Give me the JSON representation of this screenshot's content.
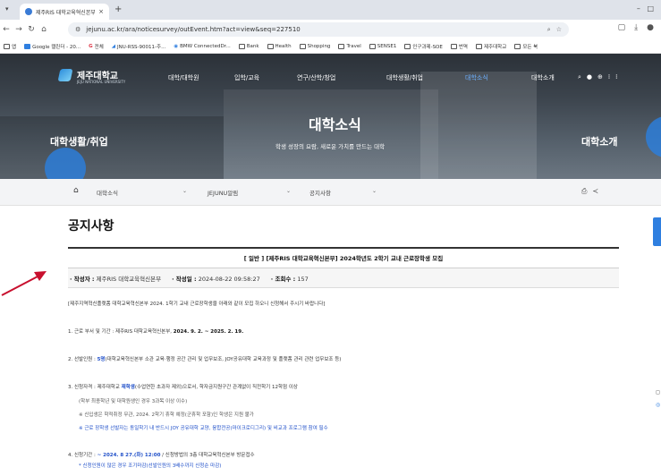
{
  "browser": {
    "tab_title": "제주RIS 대학교육혁신본부 2",
    "tab_close": "×",
    "new_tab": "+",
    "url": "jejunu.ac.kr/ara/noticesurvey/outEvent.htm?act=view&seq=227510",
    "bookmarks": [
      "앱",
      "Google 캘린더 - 20...",
      "전체",
      "JNU-RSS-90011-주...",
      "BMW ConnectedDr...",
      "Bank",
      "Health",
      "Shopping",
      "Travel",
      "SENSE1",
      "인구과제-SOE",
      "번역",
      "제주대학교",
      "모든 북"
    ]
  },
  "site": {
    "logo_name": "제주대학교",
    "logo_sub": "JEJU NATIONAL UNIVERSITY",
    "nav": [
      "대학/대학원",
      "입학/교육",
      "연구/산학/창업",
      "대학생활/취업",
      "대학소식",
      "대학소개"
    ],
    "hero_title": "대학소식",
    "hero_subtitle": "학생 성장의 요람, 새로운 가치를 만드는 대학",
    "hero_left": "대학생활/취업",
    "hero_right": "대학소개"
  },
  "breadcrumb": [
    "대학소식",
    "JEJUNU알림",
    "공지사항"
  ],
  "content": {
    "page_title": "공지사항",
    "post_title": "[ 일반 ] [제주RIS 대학교육혁신본부] 2024학년도 2학기 교내 근로장학생 모집",
    "author_label": "· 작성자 :",
    "author": "제주RIS 대학교육혁신본부",
    "date_label": "· 작성일 :",
    "date": "2024-08-22 09:58:27",
    "views_label": "· 조회수 :",
    "views": "157",
    "lines": {
      "intro": "[제주지역혁신플랫폼 대학교육혁신본부 2024. 1학기 교내 근로장학생을 아래와 같이 모집 하오니 신청해서 주시기 바랍니다]",
      "l1_prefix": "1. 근로 부서 및 기간 : 제주RIS 대학교육혁신본부, ",
      "l1_period": "2024. 9. 2. ~ 2025. 2. 19.",
      "l2_prefix": "2. 선발인원 : ",
      "l2_count": "5명",
      "l2_rest": "(대학교육혁신본부 소관 교육·행정 공간 관리 및 업무보조, JOY공유대학 교육과정 및 플랫폼 관리 관련 업무보조 등)",
      "l3_prefix": "3. 신청자격 : 제주대학교 ",
      "l3_hl": "재학생",
      "l3_rest": "(수업연한 초과자 제외)으로서, 학자금지원구간 관계없이 직전학기 12학점 이상",
      "l3_sub1": "(학부 최종학년 및 대학원생인 경우 3과목 이상 이수)",
      "l3_sub2": "※ 신입생은 학적취정 무관, 2024. 2학기 휴학 예정(군휴학 포함)인 학생은 지원 불가",
      "l3_sub3": "※ 근로 장학생 선발자는 동일학기 내 반드시 JOY 공유대학 교양, 융합전공(마이크로디그리) 및 비교과 프로그램 참여 필수",
      "l4_prefix": "4. 신청기간 : ",
      "l4_hl": "~ 2024. 8 27.(화) 12:00",
      "l4_rest": " / 신청방법의 3층 대학교육혁신본부 방문접수",
      "l4_sub": "* 신청인원이 많은 경우 조기마감(선발인원의 3배수까지 신청순 마감)"
    }
  },
  "colors": {
    "accent": "#2f7fe0",
    "link_blue": "#1f4fc9",
    "arrow": "#c8102e"
  }
}
